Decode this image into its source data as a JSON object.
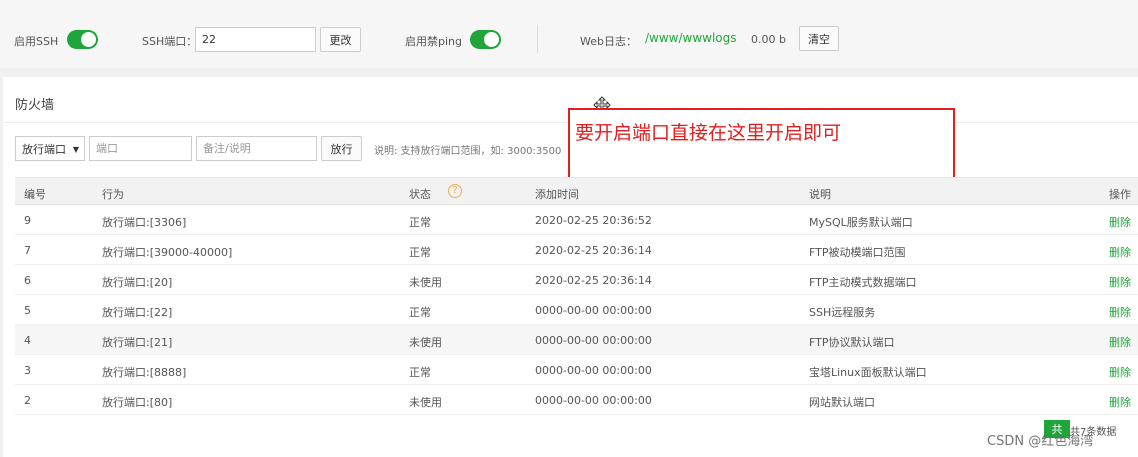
{
  "topbar": {
    "ssh_label": "启用SSH",
    "ssh_port_label": "SSH端口：",
    "ssh_port_value": "22",
    "change_btn": "更改",
    "ping_label": "启用禁ping",
    "weblog_label": "Web日志：",
    "weblog_path": "/www/wwwlogs",
    "weblog_size": "0.00 b",
    "clear_btn": "清空"
  },
  "firewall": {
    "title": "防火墙",
    "select_value": "放行端口",
    "port_placeholder": "端口",
    "note_placeholder": "备注/说明",
    "allow_btn": "放行",
    "hint": "说明: 支持放行端口范围，如: 3000:3500",
    "annotation": "要开启端口直接在这里开启即可",
    "columns": {
      "id": "编号",
      "action": "行为",
      "status": "状态",
      "time": "添加时间",
      "desc": "说明",
      "op": "操作"
    },
    "help_glyph": "?",
    "rows": [
      {
        "id": "9",
        "action": "放行端口:[3306]",
        "status": "正常",
        "time": "2020-02-25 20:36:52",
        "desc": "MySQL服务默认端口",
        "op": "删除"
      },
      {
        "id": "7",
        "action": "放行端口:[39000-40000]",
        "status": "正常",
        "time": "2020-02-25 20:36:14",
        "desc": "FTP被动模端口范围",
        "op": "删除"
      },
      {
        "id": "6",
        "action": "放行端口:[20]",
        "status": "未使用",
        "time": "2020-02-25 20:36:14",
        "desc": "FTP主动模式数据端口",
        "op": "删除"
      },
      {
        "id": "5",
        "action": "放行端口:[22]",
        "status": "正常",
        "time": "0000-00-00 00:00:00",
        "desc": "SSH远程服务",
        "op": "删除"
      },
      {
        "id": "4",
        "action": "放行端口:[21]",
        "status": "未使用",
        "time": "0000-00-00 00:00:00",
        "desc": "FTP协议默认端口",
        "op": "删除"
      },
      {
        "id": "3",
        "action": "放行端口:[8888]",
        "status": "正常",
        "time": "0000-00-00 00:00:00",
        "desc": "宝塔Linux面板默认端口",
        "op": "删除"
      },
      {
        "id": "2",
        "action": "放行端口:[80]",
        "status": "未使用",
        "time": "0000-00-00 00:00:00",
        "desc": "网站默认端口",
        "op": "删除"
      }
    ],
    "pager_badge": "共",
    "pager_text": "共7条数据"
  },
  "watermark": "CSDN @红色海湾",
  "colors": {
    "accent": "#20a53a",
    "annotation": "#e02020"
  }
}
